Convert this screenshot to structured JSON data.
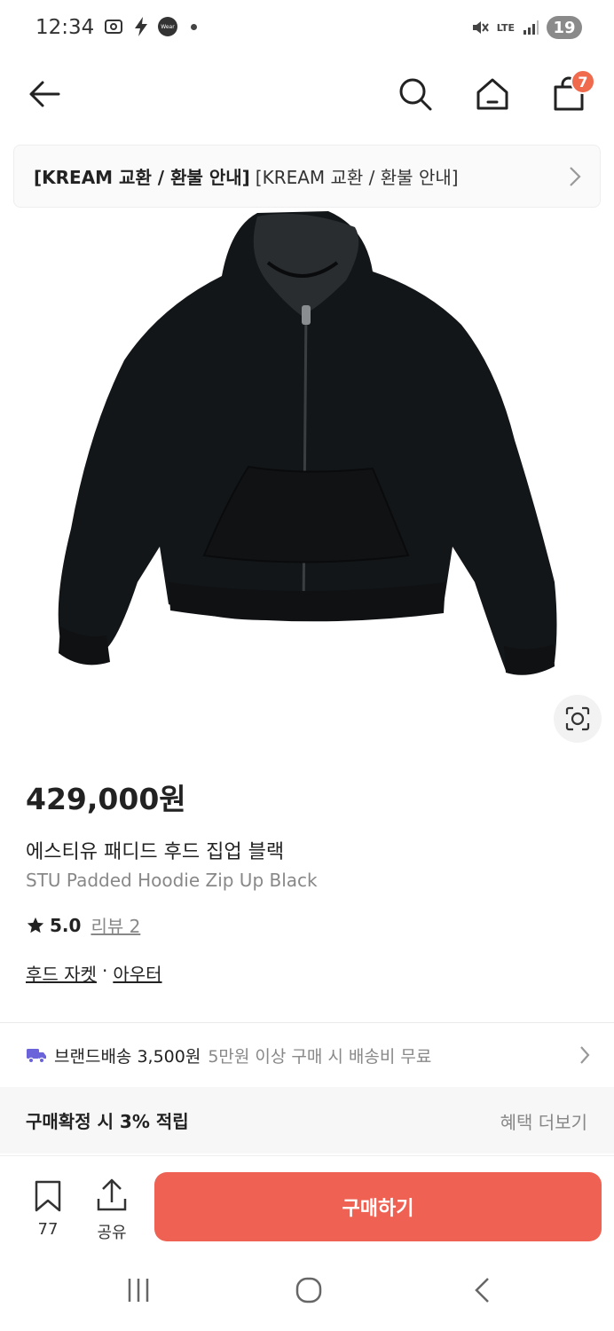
{
  "status": {
    "time": "12:34",
    "wear_label": "Wear",
    "network": "LTE",
    "battery": "19"
  },
  "nav": {
    "cart_count": "7"
  },
  "notice": {
    "bold": "[KREAM 교환 / 환불 안내]",
    "normal": "[KREAM 교환 / 환불 안내]"
  },
  "product": {
    "price": "429,000원",
    "name_ko": "에스티유 패디드 후드 집업 블랙",
    "name_en": "STU Padded Hoodie Zip Up Black",
    "rating": "5.0",
    "review_label": "리뷰 2",
    "category_1": "후드 자켓",
    "category_sep": "·",
    "category_2": "아우터"
  },
  "delivery": {
    "main": "브랜드배송 3,500원",
    "sub": "5만원 이상 구매 시 배송비 무료"
  },
  "benefit": {
    "label": "구매확정 시 3% 적립",
    "more": "혜택 더보기"
  },
  "bottom": {
    "bookmark_count": "77",
    "share_label": "공유",
    "buy_label": "구매하기"
  },
  "colors": {
    "accent": "#ef6253",
    "badge": "#f06a4e",
    "delivery_truck": "#6b63d9"
  }
}
